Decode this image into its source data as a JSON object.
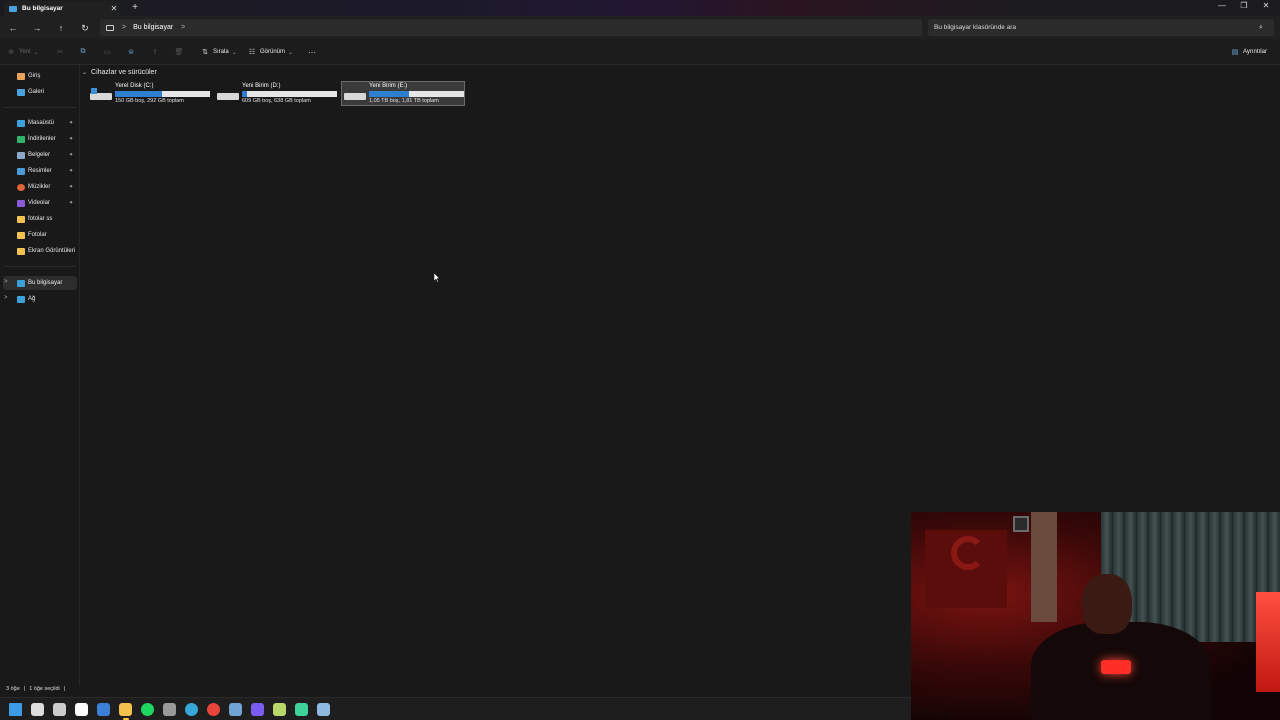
{
  "window": {
    "tab_title": "Bu bilgisayar",
    "tab_close": "✕",
    "new_tab": "+",
    "controls": {
      "minimize": "—",
      "maximize": "❐",
      "close": "✕"
    }
  },
  "nav": {
    "back": "←",
    "forward": "→",
    "up": "↑",
    "refresh": "↻",
    "breadcrumb": [
      "Bu bilgisayar"
    ],
    "crumb_sep": ">",
    "search_placeholder": "Bu bilgisayar klasöründe ara"
  },
  "toolbar": {
    "new_label": "Yeni",
    "sort_label": "Sırala",
    "view_label": "Görünüm",
    "more_label": "···",
    "details_label": "Ayrıntılar"
  },
  "sidebar": {
    "top": [
      {
        "label": "Giriş",
        "icon": "home-icon",
        "color": "#e8a35a"
      },
      {
        "label": "Galeri",
        "icon": "gallery-icon",
        "color": "#4aa3df"
      }
    ],
    "pinned": [
      {
        "label": "Masaüstü",
        "icon": "desktop-icon",
        "color": "#3ba2d9",
        "pinned": true
      },
      {
        "label": "İndirilenler",
        "icon": "downloads-icon",
        "color": "#2fb36b",
        "pinned": true
      },
      {
        "label": "Belgeler",
        "icon": "documents-icon",
        "color": "#8aa8c8",
        "pinned": true
      },
      {
        "label": "Resimler",
        "icon": "pictures-icon",
        "color": "#4a9ad6",
        "pinned": true
      },
      {
        "label": "Müzikler",
        "icon": "music-icon",
        "color": "#e0653a",
        "pinned": true
      },
      {
        "label": "Videolar",
        "icon": "videos-icon",
        "color": "#8b5cd6",
        "pinned": true
      },
      {
        "label": "fotolar ss",
        "icon": "folder-icon",
        "color": "#f2c14e",
        "pinned": false
      },
      {
        "label": "Fotolar",
        "icon": "folder-icon",
        "color": "#f2c14e",
        "pinned": false
      },
      {
        "label": "Ekran Görüntüleri",
        "icon": "folder-icon",
        "color": "#f2c14e",
        "pinned": false
      }
    ],
    "bottom": [
      {
        "label": "Bu bilgisayar",
        "icon": "computer-icon",
        "color": "#3ba2d9",
        "active": true
      },
      {
        "label": "Ağ",
        "icon": "network-icon",
        "color": "#3ba2d9",
        "active": false
      }
    ],
    "pin_glyph": "📌",
    "expand_glyph": ">"
  },
  "main": {
    "section_title": "Cihazlar ve sürücüler",
    "drives": [
      {
        "name": "Yerel Disk (C:)",
        "size_text": "150 GB boş, 292 GB toplam",
        "used_fraction": 0.49,
        "system": true
      },
      {
        "name": "Yeni Birim (D:)",
        "size_text": "609 GB boş, 638 GB toplam",
        "used_fraction": 0.05,
        "system": false
      },
      {
        "name": "Yeni Birim (E:)",
        "size_text": "1,05 TB boş, 1,81 TB toplam",
        "used_fraction": 0.42,
        "system": false,
        "selected": true
      }
    ]
  },
  "status": {
    "item_count": "3 öğe",
    "selected": "1 öğe seçildi",
    "sep": "|"
  },
  "taskbar": {
    "apps": [
      {
        "icon": "windows-start-icon",
        "color": "#3b9be6"
      },
      {
        "icon": "search-icon",
        "color": "#dddddd"
      },
      {
        "icon": "task-view-icon",
        "color": "#cccccc"
      },
      {
        "icon": "store-icon",
        "color": "#ffffff"
      },
      {
        "icon": "browser-icon",
        "color": "#3b7fd6"
      },
      {
        "icon": "file-explorer-icon",
        "color": "#f2c14e",
        "active": true
      },
      {
        "icon": "spotify-icon",
        "color": "#1ed760"
      },
      {
        "icon": "settings-icon",
        "color": "#9a9a9a"
      },
      {
        "icon": "edge-icon",
        "color": "#36a7d8"
      },
      {
        "icon": "chrome-icon",
        "color": "#e8453c"
      },
      {
        "icon": "steam-icon",
        "color": "#6fa4d4"
      },
      {
        "icon": "discord-icon",
        "color": "#7a5cf0"
      },
      {
        "icon": "app-icon",
        "color": "#b8d86a"
      },
      {
        "icon": "media-icon",
        "color": "#3fd19a"
      },
      {
        "icon": "steam-alt-icon",
        "color": "#8fb8e0"
      }
    ]
  }
}
